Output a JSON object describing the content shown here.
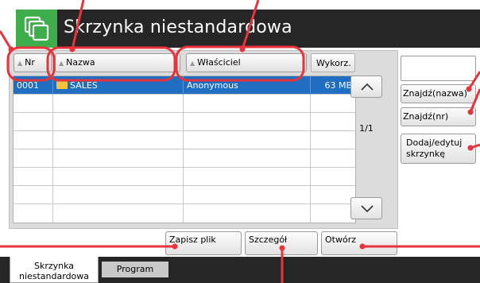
{
  "header": {
    "title": "Skrzynka niestandardowa",
    "icon": "box-stack-icon",
    "icon_bg": "#3dae49",
    "bar_bg": "#262626"
  },
  "list": {
    "columns": [
      "Nr",
      "Nazwa",
      "Właściciel",
      "Wykorz."
    ],
    "rows": [
      {
        "nr": "0001",
        "name": "SALES",
        "owner": "Anonymous",
        "usage": "63",
        "unit": "MB",
        "selected": true
      }
    ],
    "empty_row_count": 7,
    "selection_color": "#1f6ec2",
    "page_indicator": "1/1"
  },
  "right_buttons": {
    "find_name": "Znajdź(nazwa)",
    "find_nr": "Znajdź(nr)",
    "add_edit": "Dodaj/edytuj skrzynkę"
  },
  "bottom_buttons": {
    "save_file": "Zapisz plik",
    "detail": "Szczegół",
    "open": "Otwórz"
  },
  "tabs": {
    "active": "Skrzynka niestandardowa",
    "program": "Program"
  },
  "annotation_color": "#e8323c"
}
